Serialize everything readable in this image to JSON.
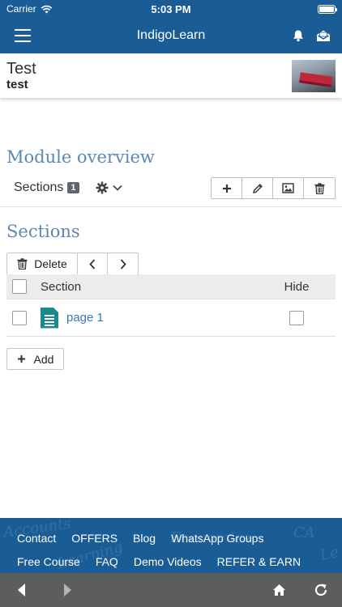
{
  "status_bar": {
    "carrier": "Carrier",
    "time": "5:03 PM"
  },
  "app_bar": {
    "title": "IndigoLearn"
  },
  "course": {
    "title": "Test",
    "subtitle": "test"
  },
  "module": {
    "heading": "Module overview",
    "tab_label": "Sections",
    "tab_count": "1"
  },
  "sections": {
    "heading": "Sections",
    "delete_label": "Delete",
    "table": {
      "col_section": "Section",
      "col_hide": "Hide",
      "rows": [
        {
          "name": "page 1",
          "hidden": false
        }
      ]
    },
    "add_label": "Add"
  },
  "footer": {
    "row1": [
      "Contact",
      "OFFERS",
      "Blog",
      "WhatsApp Groups"
    ],
    "row2": [
      "Free Course",
      "FAQ",
      "Demo Videos",
      "REFER & EARN"
    ]
  },
  "colors": {
    "primary": "#1a5c96",
    "heading": "#5b88b4",
    "link": "#3a78b5",
    "file_icon": "#1a8b8d",
    "bottom_bar": "#5d5d5d"
  },
  "icons": [
    "wifi-icon",
    "battery-icon",
    "menu-icon",
    "bell-icon",
    "mail-icon",
    "gear-icon",
    "chevron-down-icon",
    "plus-icon",
    "pencil-icon",
    "image-icon",
    "trash-icon",
    "chevron-left-icon",
    "chevron-right-icon",
    "file-icon",
    "back-icon",
    "forward-icon",
    "home-icon",
    "refresh-icon"
  ]
}
